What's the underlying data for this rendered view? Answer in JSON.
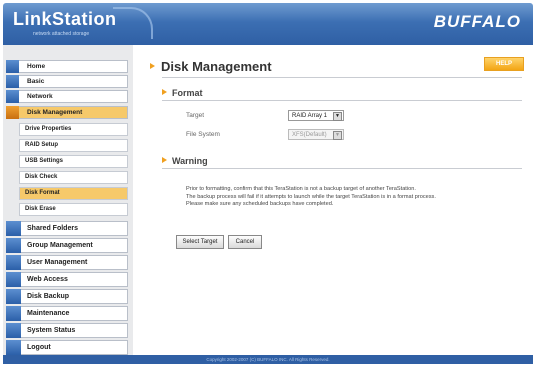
{
  "header": {
    "logo": "LinkStation",
    "logo_sub": "network attached storage",
    "brand": "BUFFALO"
  },
  "sidebar": {
    "top_items": [
      {
        "label": "Home",
        "icon": "home-icon"
      },
      {
        "label": "Basic",
        "icon": "basic-icon"
      },
      {
        "label": "Network",
        "icon": "network-icon"
      },
      {
        "label": "Disk Management",
        "icon": "disk-icon"
      }
    ],
    "sub_items": [
      {
        "label": "Drive Properties"
      },
      {
        "label": "RAID Setup"
      },
      {
        "label": "USB Settings"
      },
      {
        "label": "Disk Check"
      },
      {
        "label": "Disk Format"
      },
      {
        "label": "Disk Erase"
      }
    ],
    "bottom_items": [
      {
        "label": "Shared Folders",
        "icon": "folder-icon"
      },
      {
        "label": "Group Management",
        "icon": "group-icon"
      },
      {
        "label": "User Management",
        "icon": "user-icon"
      },
      {
        "label": "Web Access",
        "icon": "web-icon"
      },
      {
        "label": "Disk Backup",
        "icon": "backup-icon"
      },
      {
        "label": "Maintenance",
        "icon": "maintenance-icon"
      },
      {
        "label": "System Status",
        "icon": "status-icon"
      },
      {
        "label": "Logout",
        "icon": "logout-icon"
      }
    ]
  },
  "main": {
    "title": "Disk Management",
    "help_label": "HELP",
    "format_section": "Format",
    "target_label": "Target",
    "target_value": "RAID Array 1",
    "filesystem_label": "File System",
    "filesystem_value": "XFS(Default)",
    "warning_section": "Warning",
    "warning_lines": [
      "Prior to formatting, confirm that this TeraStation is not a backup target of another TeraStation.",
      "The backup process will fail if it attempts to launch while the target TeraStation is in a format process.",
      "Please make sure any scheduled backups have completed."
    ],
    "select_target_button": "Select Target",
    "cancel_button": "Cancel"
  },
  "footer": {
    "copyright": "Copyright 2002-2007 (C) BUFFALO INC. All Rights Reserved."
  },
  "colors": {
    "header": "#2f5fa4",
    "active": "#f6c96a",
    "accent": "#f0a020"
  }
}
